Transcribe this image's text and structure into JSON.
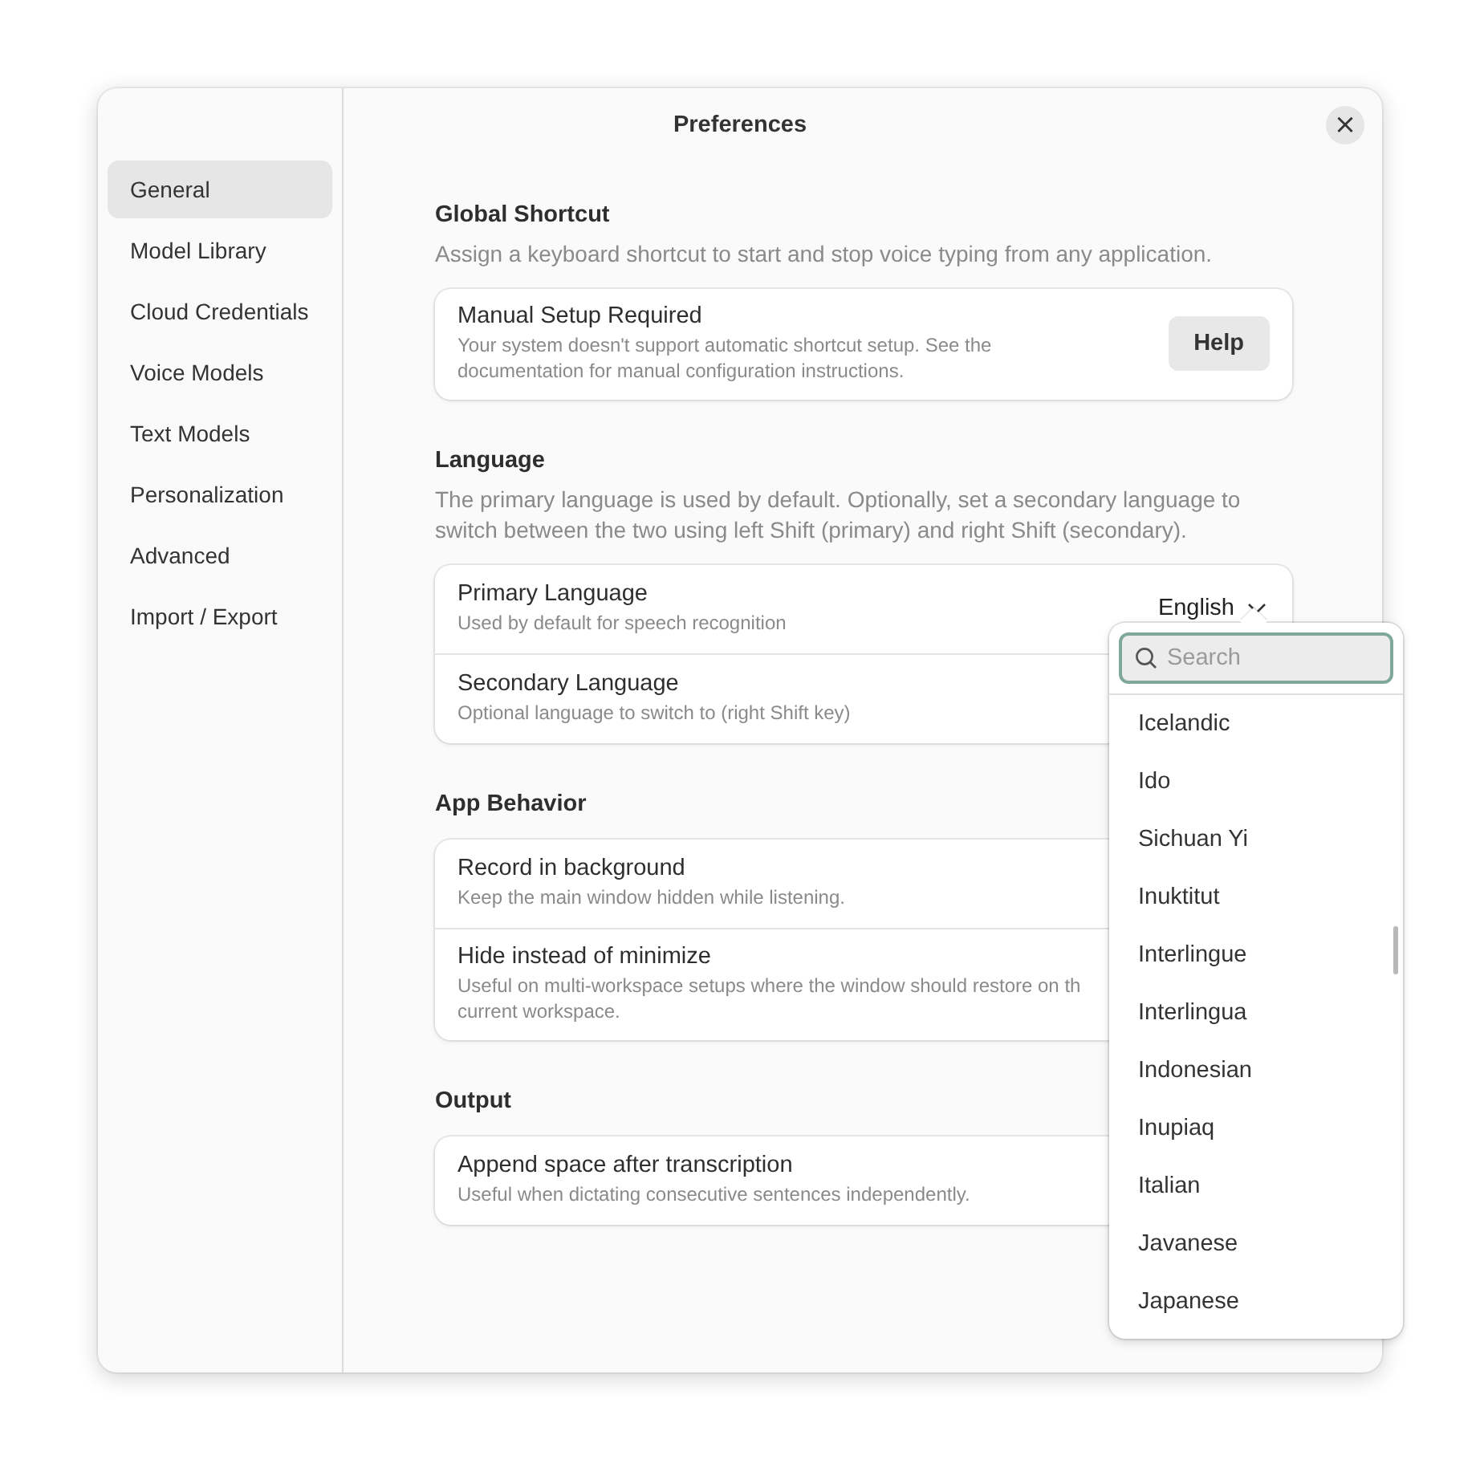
{
  "window": {
    "title": "Preferences",
    "close": "×"
  },
  "sidebar": {
    "items": [
      {
        "label": "General",
        "selected": true
      },
      {
        "label": "Model Library",
        "selected": false
      },
      {
        "label": "Cloud Credentials",
        "selected": false
      },
      {
        "label": "Voice Models",
        "selected": false
      },
      {
        "label": "Text Models",
        "selected": false
      },
      {
        "label": "Personalization",
        "selected": false
      },
      {
        "label": "Advanced",
        "selected": false
      },
      {
        "label": "Import / Export",
        "selected": false
      }
    ]
  },
  "sections": [
    {
      "title": "Global Shortcut",
      "description": "Assign a keyboard shortcut to start and stop voice typing from any application.",
      "rows": [
        {
          "kind": "button",
          "title": "Manual Setup Required",
          "description": "Your system doesn't support automatic shortcut setup. See the\ndocumentation for manual configuration instructions.",
          "button": "Help"
        }
      ]
    },
    {
      "title": "Language",
      "description": "The primary language is used by default. Optionally, set a secondary language to switch between the two using left Shift (primary) and right Shift (secondary).",
      "rows": [
        {
          "kind": "dropdown",
          "title": "Primary Language",
          "description": "Used by default for speech recognition",
          "value": "English",
          "expanded": true
        },
        {
          "kind": "plain",
          "title": "Secondary Language",
          "description": "Optional language to switch to (right Shift key)"
        }
      ]
    },
    {
      "title": "App Behavior",
      "rows": [
        {
          "kind": "plain",
          "title": "Record in background",
          "description": "Keep the main window hidden while listening."
        },
        {
          "kind": "plain",
          "title": "Hide instead of minimize",
          "description": "Useful on multi-workspace setups where the window should restore on th\ncurrent workspace."
        }
      ]
    },
    {
      "title": "Output",
      "rows": [
        {
          "kind": "plain",
          "title": "Append space after transcription",
          "description": "Useful when dictating consecutive sentences independently."
        }
      ]
    }
  ],
  "language_menu": {
    "search": {
      "placeholder": "Search"
    },
    "options": [
      "Icelandic",
      "Ido",
      "Sichuan Yi",
      "Inuktitut",
      "Interlingue",
      "Interlingua",
      "Indonesian",
      "Inupiaq",
      "Italian",
      "Javanese",
      "Japanese"
    ]
  }
}
